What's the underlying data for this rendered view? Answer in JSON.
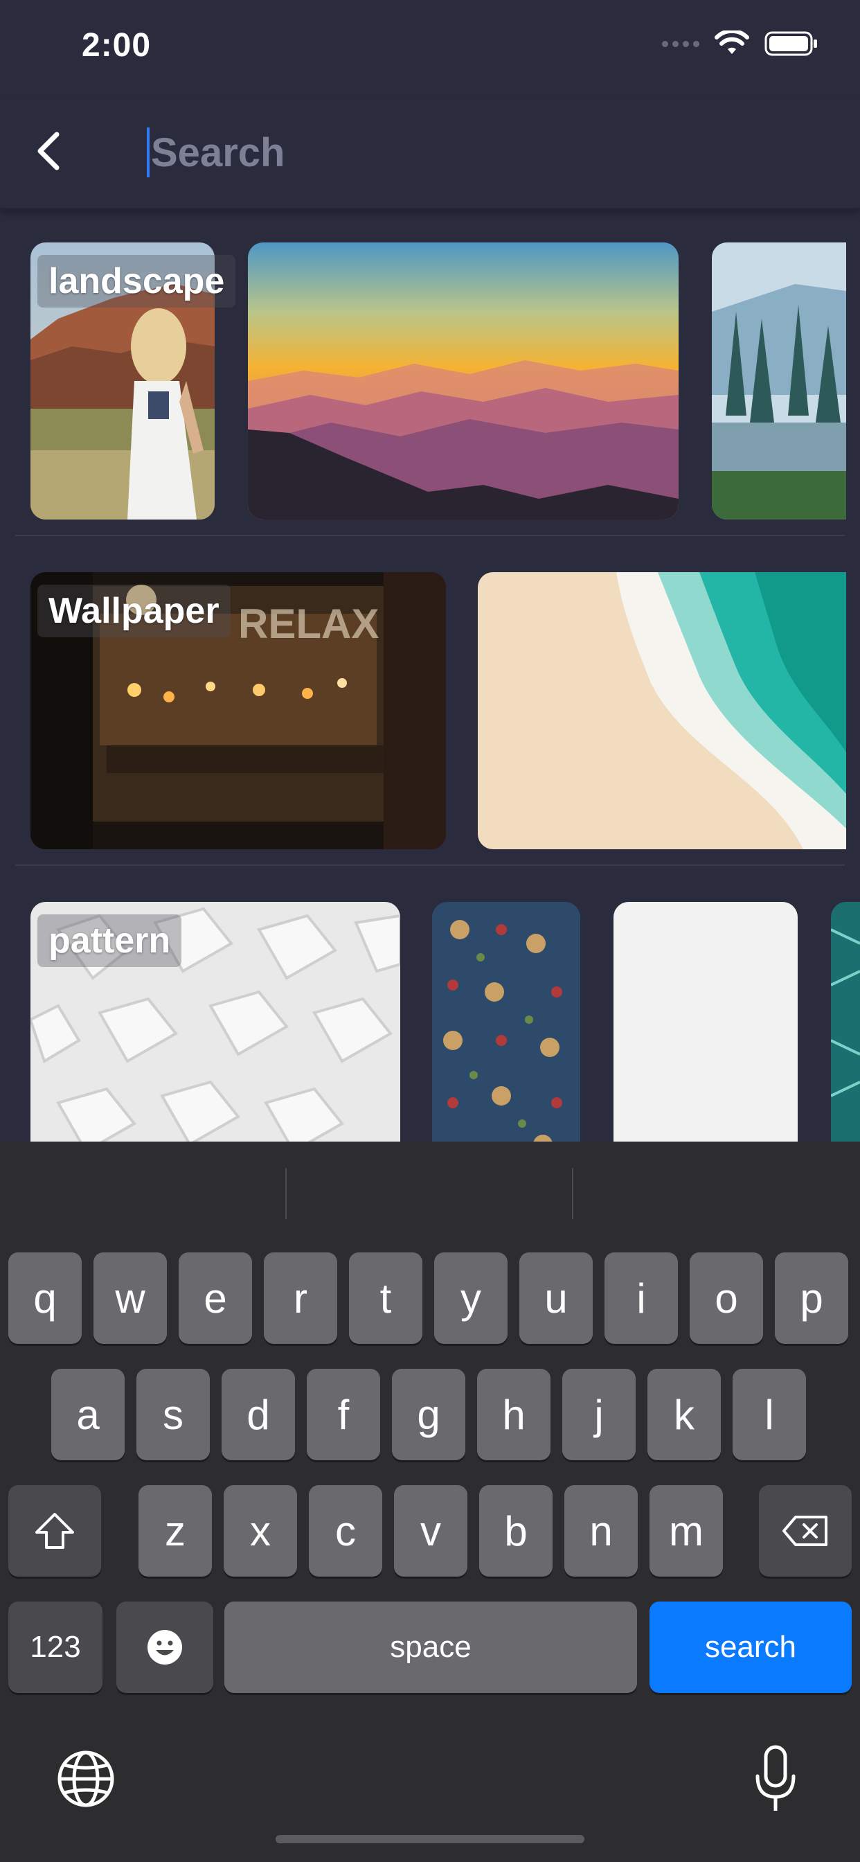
{
  "status": {
    "time": "2:00"
  },
  "search": {
    "placeholder": "Search",
    "value": ""
  },
  "rows": [
    {
      "label": "landscape"
    },
    {
      "label": "Wallpaper"
    },
    {
      "label": "pattern"
    }
  ],
  "keyboard": {
    "row1": [
      "q",
      "w",
      "e",
      "r",
      "t",
      "y",
      "u",
      "i",
      "o",
      "p"
    ],
    "row2": [
      "a",
      "s",
      "d",
      "f",
      "g",
      "h",
      "j",
      "k",
      "l"
    ],
    "row3": [
      "z",
      "x",
      "c",
      "v",
      "b",
      "n",
      "m"
    ],
    "numbers_label": "123",
    "space_label": "space",
    "search_label": "search"
  },
  "colors": {
    "background": "#2a2b3d",
    "accent": "#0a7aff",
    "caret": "#2f7cf6"
  },
  "icons": [
    "back-chevron-icon",
    "wifi-icon",
    "battery-icon",
    "shift-icon",
    "delete-icon",
    "emoji-icon",
    "globe-icon",
    "microphone-icon"
  ]
}
